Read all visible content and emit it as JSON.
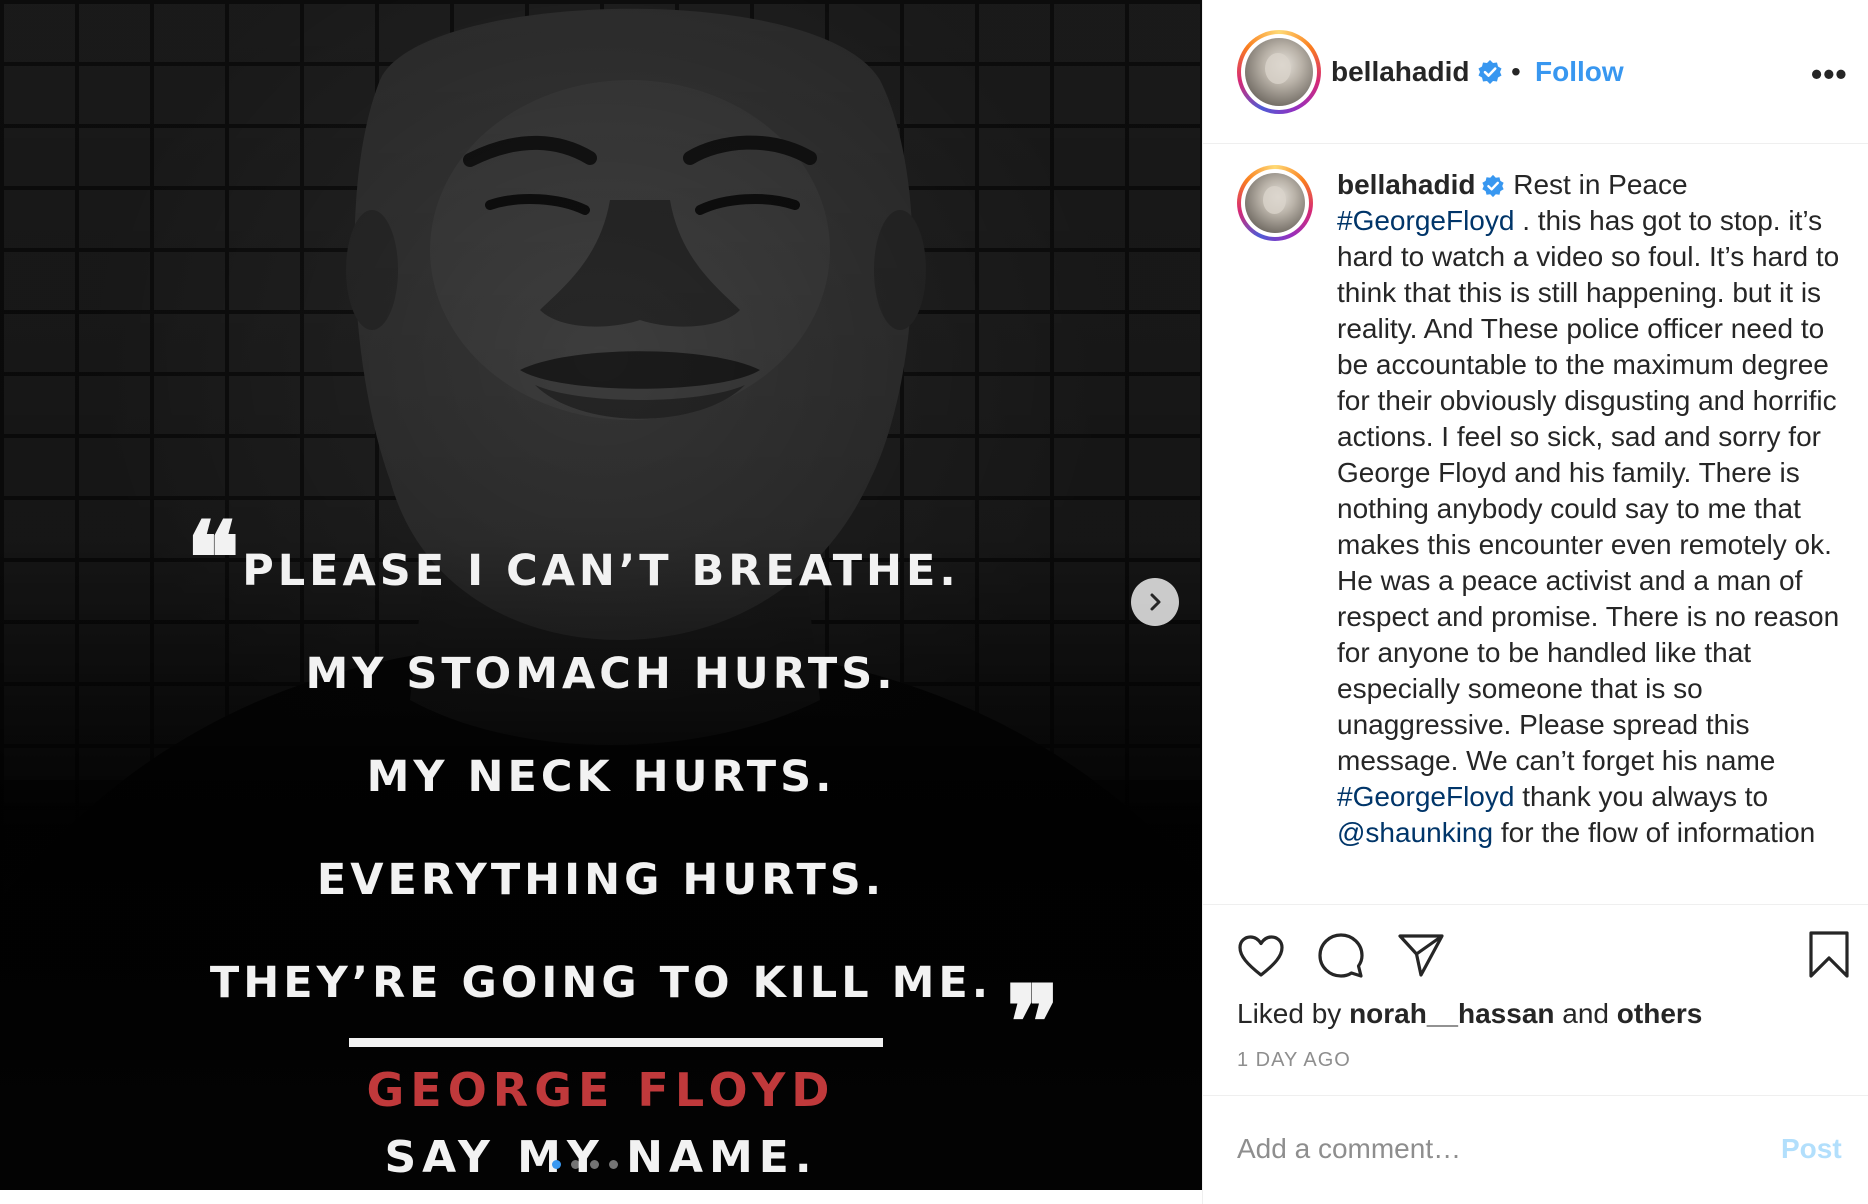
{
  "post": {
    "image": {
      "quote_lines": [
        "PLEASE I CAN’T BREATHE.",
        "MY STOMACH HURTS.",
        "MY NECK HURTS.",
        "EVERYTHING HURTS.",
        "THEY’RE GOING TO KILL ME."
      ],
      "open_quote": "❝",
      "close_quote": "❞",
      "name": "GEORGE FLOYD",
      "tagline": "SAY MY NAME.",
      "carousel_dots": 4,
      "active_dot": 0
    },
    "header": {
      "username": "bellahadid",
      "separator": "•",
      "follow_label": "Follow",
      "more_label": "•••"
    },
    "caption": {
      "username": "bellahadid",
      "text_1": " Rest in Peace ",
      "hashtag_1": "#GeorgeFloyd",
      "text_2": " . this has got to stop. it’s hard to watch a video so foul. It’s hard to think that this is still happening. but it is reality. And These police officer need to be accountable to the maximum degree for their obviously disgusting and horrific actions. I feel so sick, sad and sorry for George Floyd and his family. There is nothing anybody could say to me that makes this encounter even remotely ok. He was a peace activist and a man of respect and promise. There is no reason for anyone to be handled like that especially someone that is so unaggressive. Please spread this message. We can’t forget his name ",
      "hashtag_2": "#GeorgeFloyd",
      "text_3": " thank you always to ",
      "mention": "@shaunking",
      "text_4": " for the flow of information"
    },
    "engagement": {
      "liked_prefix": "Liked by ",
      "liked_user": "norah__hassan",
      "liked_and": " and ",
      "liked_others": "others",
      "timestamp": "1 DAY AGO"
    },
    "comment": {
      "placeholder": "Add a comment…",
      "post_label": "Post"
    },
    "colors": {
      "link_blue": "#3897f0",
      "hashtag": "#003569",
      "name_red": "#c0393b",
      "post_disabled": "#b2dffc"
    }
  }
}
